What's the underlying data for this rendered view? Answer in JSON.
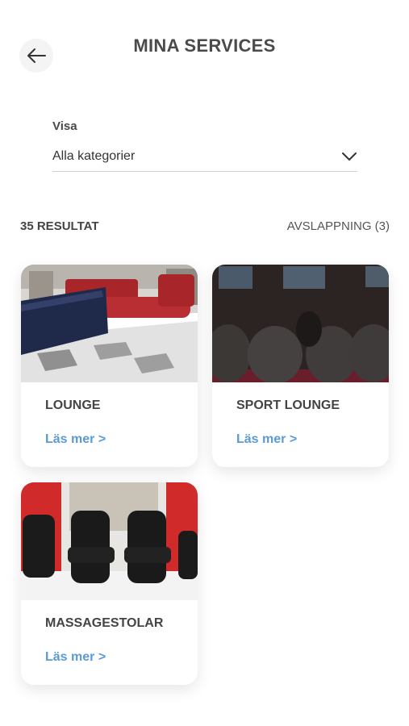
{
  "header": {
    "title": "MINA SERVICES",
    "back_icon": "arrow-left-icon"
  },
  "filter": {
    "label": "Visa",
    "value": "Alla kategorier",
    "icon": "chevron-down-icon"
  },
  "results": {
    "count_label": "35 RESULTAT",
    "category_label": "AVSLAPPNING (3)"
  },
  "cards": [
    {
      "title": "LOUNGE",
      "link": "Läs mer >"
    },
    {
      "title": "SPORT LOUNGE",
      "link": "Läs mer >"
    },
    {
      "title": "MASSAGESTOLAR",
      "link": "Läs mer >"
    }
  ],
  "colors": {
    "accent": "#5b9bd5",
    "text": "#444444"
  }
}
